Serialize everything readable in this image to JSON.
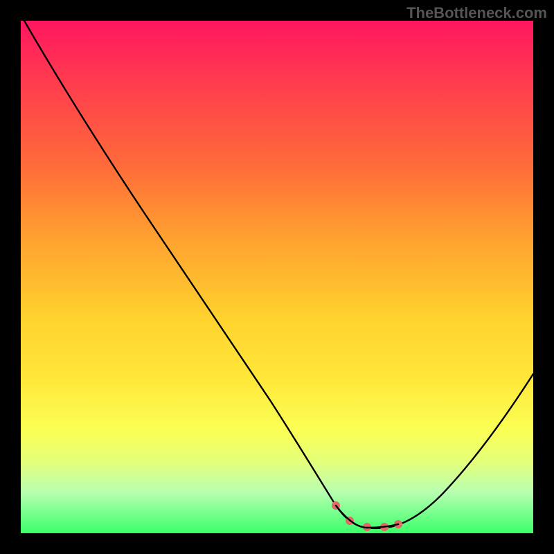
{
  "watermark": "TheBottleneck.com",
  "chart_data": {
    "type": "line",
    "title": "",
    "xlabel": "",
    "ylabel": "",
    "xlim": [
      0,
      100
    ],
    "ylim": [
      0,
      100
    ],
    "grid": false,
    "legend": false,
    "series": [
      {
        "name": "curve",
        "color": "#000000",
        "x": [
          0,
          5,
          10,
          15,
          20,
          25,
          30,
          35,
          40,
          45,
          50,
          55,
          60,
          62,
          65,
          70,
          73,
          78,
          82,
          88,
          94,
          100
        ],
        "y": [
          100,
          94,
          88,
          82,
          75,
          68,
          61,
          54,
          47,
          39,
          31,
          22,
          12,
          7,
          3,
          1,
          1,
          2,
          6,
          13,
          22,
          33
        ]
      }
    ],
    "highlight": {
      "name": "flat-region",
      "color": "#e06a68",
      "x": [
        62,
        65,
        70,
        73
      ],
      "y": [
        7,
        3,
        1,
        1
      ]
    }
  }
}
